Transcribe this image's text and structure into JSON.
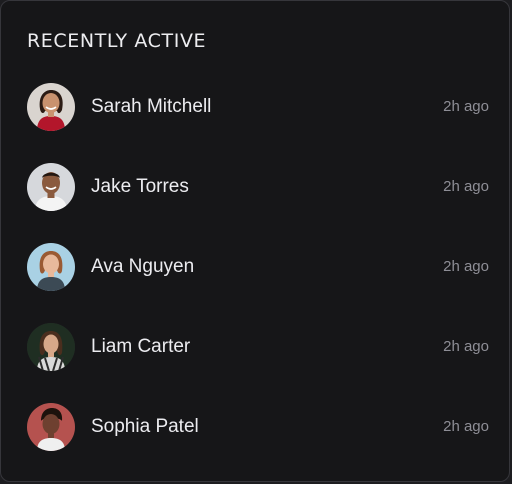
{
  "panel": {
    "title": "RECENTLY ACTIVE"
  },
  "users": [
    {
      "name": "Sarah Mitchell",
      "time": "2h ago",
      "avatar_icon": "person-avatar-icon"
    },
    {
      "name": "Jake Torres",
      "time": "2h ago",
      "avatar_icon": "person-avatar-icon"
    },
    {
      "name": "Ava Nguyen",
      "time": "2h ago",
      "avatar_icon": "person-avatar-icon"
    },
    {
      "name": "Liam Carter",
      "time": "2h ago",
      "avatar_icon": "person-avatar-icon"
    },
    {
      "name": "Sophia Patel",
      "time": "2h ago",
      "avatar_icon": "person-avatar-icon"
    }
  ],
  "colors": {
    "background": "#161618",
    "border": "#36363b",
    "text": "#ececf0",
    "muted": "#8e8e96"
  }
}
